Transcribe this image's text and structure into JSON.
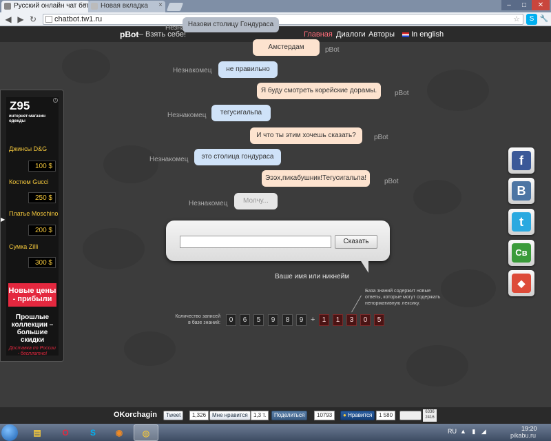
{
  "browser": {
    "tabs": [
      {
        "title": "Русский онлайн чат бот",
        "active": true
      },
      {
        "title": "Новая вкладка",
        "active": false
      }
    ],
    "url": "chatbot.tw1.ru",
    "window_controls": {
      "minimize": "–",
      "maximize": "□",
      "close": "✕"
    }
  },
  "site": {
    "logo": "pBot",
    "tagline": "— Взять себе!",
    "nav": [
      {
        "label": "Главная",
        "active": true
      },
      {
        "label": "Диалоги",
        "active": false
      },
      {
        "label": "Авторы",
        "active": false
      },
      {
        "label": "In english",
        "active": false
      }
    ]
  },
  "chat": {
    "messages": [
      {
        "speaker": "Незнакомец",
        "text": "Назови столицу Гондураса",
        "role": "user"
      },
      {
        "speaker": "pBot",
        "text": "Амстердам",
        "role": "bot"
      },
      {
        "speaker": "Незнакомец",
        "text": "не правильно",
        "role": "user"
      },
      {
        "speaker": "pBot",
        "text": "Я буду смотреть корейские дорамы.",
        "role": "bot"
      },
      {
        "speaker": "Незнакомец",
        "text": "тегусигальпа",
        "role": "user"
      },
      {
        "speaker": "pBot",
        "text": "И что ты этим хочешь сказать?",
        "role": "bot"
      },
      {
        "speaker": "Незнакомец",
        "text": "это столица гондураса",
        "role": "user"
      },
      {
        "speaker": "pBot",
        "text": "Эээх,пикабушник!Тегусигальпа!",
        "role": "bot"
      },
      {
        "speaker": "Незнакомец",
        "text": "Молчу...",
        "role": "pending"
      }
    ],
    "input": {
      "value": "",
      "button": "Сказать"
    },
    "nickname_prompt": "Ваше имя или никнейм"
  },
  "stats": {
    "label": "Количество записей в базе знаний:",
    "digits_main": [
      "0",
      "6",
      "5",
      "9",
      "8",
      "9"
    ],
    "plus": "+",
    "digits_new": [
      "1",
      "1",
      "3",
      "0",
      "5"
    ],
    "note": "База знаний содержит новые ответы, которые могут содержать ненормативную лексику."
  },
  "ad": {
    "brand": "Z95",
    "subtitle": "интернет-магазин одежды",
    "info": "i",
    "products": [
      {
        "name": "Джинсы D&G",
        "price": "100 $"
      },
      {
        "name": "Костюм Gucci",
        "price": "250 $"
      },
      {
        "name": "Платье Moschino",
        "price": "200 $"
      },
      {
        "name": "Сумка Zilli",
        "price": "300 $"
      }
    ],
    "promo": "Новые цены - прибыли",
    "collections": "Прошлые коллекции – большие скидки",
    "delivery": "Доставка по России - бесплатно!"
  },
  "social": [
    {
      "name": "facebook",
      "glyph": "f",
      "color": "#3b5998"
    },
    {
      "name": "vkontakte",
      "glyph": "B",
      "color": "#4c75a3"
    },
    {
      "name": "twitter",
      "glyph": "t",
      "color": "#2aa9e0"
    },
    {
      "name": "svoi",
      "glyph": "Св",
      "color": "#3a9b3a"
    },
    {
      "name": "google-buzz",
      "glyph": "◆",
      "color": "#dd4b39"
    }
  ],
  "footer": {
    "author": "OKorchagin",
    "tweet": "Tweet",
    "tweet_count": "1,326",
    "fb_like": "Мне нравится",
    "fb_count": "1,3 т.",
    "vk_share": "Поделиться",
    "vk_count": "10793",
    "mail_like": "Нравится",
    "mail_count": "1 580",
    "counter_top": "6336",
    "counter_bottom": "2416"
  },
  "taskbar": {
    "lang": "RU",
    "time": "19:20",
    "watermark": "pikabu.ru"
  }
}
